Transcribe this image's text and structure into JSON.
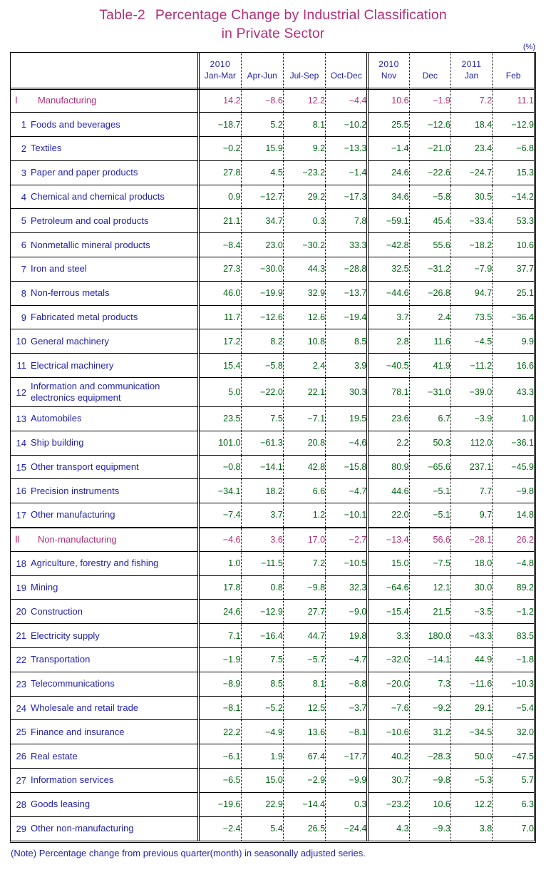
{
  "title": {
    "label": "Table-2",
    "line1": "Percentage Change by Industrial Classification",
    "line2": "in Private Sector"
  },
  "unit": "(%)",
  "note": "(Note) Percentage change from previous quarter(month) in seasonally adjusted series.",
  "colors": {
    "title": "#b0307a",
    "label_text": "#2222aa",
    "value_positive": "#006611",
    "major_row": "#b0307a"
  },
  "header": {
    "label_column": "",
    "columns": [
      {
        "year": "2010",
        "period": "Jan-Mar",
        "group": "quarter"
      },
      {
        "year": "",
        "period": "Apr-Jun",
        "group": "quarter"
      },
      {
        "year": "",
        "period": "Jul-Sep",
        "group": "quarter"
      },
      {
        "year": "",
        "period": "Oct-Dec",
        "group": "quarter"
      },
      {
        "year": "2010",
        "period": "Nov",
        "group": "month"
      },
      {
        "year": "",
        "period": "Dec",
        "group": "month"
      },
      {
        "year": "2011",
        "period": "Jan",
        "group": "month"
      },
      {
        "year": "",
        "period": "Feb",
        "group": "month"
      }
    ]
  },
  "rows": [
    {
      "num": "Ⅰ",
      "label": "Manufacturing",
      "major": true,
      "tall": false,
      "values": [
        "14.2",
        "−8.6",
        "12.2",
        "−4.4",
        "10.6",
        "−1.9",
        "7.2",
        "11.1"
      ]
    },
    {
      "num": "1",
      "label": "Foods and beverages",
      "major": false,
      "tall": false,
      "values": [
        "−18.7",
        "5.2",
        "8.1",
        "−10.2",
        "25.5",
        "−12.6",
        "18.4",
        "−12.9"
      ]
    },
    {
      "num": "2",
      "label": "Textiles",
      "major": false,
      "tall": false,
      "values": [
        "−0.2",
        "15.9",
        "9.2",
        "−13.3",
        "−1.4",
        "−21.0",
        "23.4",
        "−6.8"
      ]
    },
    {
      "num": "3",
      "label": "Paper and paper products",
      "major": false,
      "tall": false,
      "values": [
        "27.8",
        "4.5",
        "−23.2",
        "−1.4",
        "24.6",
        "−22.6",
        "−24.7",
        "15.3"
      ]
    },
    {
      "num": "4",
      "label": "Chemical and chemical products",
      "major": false,
      "tall": false,
      "values": [
        "0.9",
        "−12.7",
        "29.2",
        "−17.3",
        "34.6",
        "−5.8",
        "30.5",
        "−14.2"
      ]
    },
    {
      "num": "5",
      "label": "Petroleum and coal products",
      "major": false,
      "tall": false,
      "values": [
        "21.1",
        "34.7",
        "0.3",
        "7.8",
        "−59.1",
        "45.4",
        "−33.4",
        "53.3"
      ]
    },
    {
      "num": "6",
      "label": "Nonmetallic mineral products",
      "major": false,
      "tall": false,
      "values": [
        "−8.4",
        "23.0",
        "−30.2",
        "33.3",
        "−42.8",
        "55.6",
        "−18.2",
        "10.6"
      ]
    },
    {
      "num": "7",
      "label": "Iron and steel",
      "major": false,
      "tall": false,
      "values": [
        "27.3",
        "−30.0",
        "44.3",
        "−28.8",
        "32.5",
        "−31.2",
        "−7.9",
        "37.7"
      ]
    },
    {
      "num": "8",
      "label": "Non-ferrous metals",
      "major": false,
      "tall": false,
      "values": [
        "46.0",
        "−19.9",
        "32.9",
        "−13.7",
        "−44.6",
        "−26.8",
        "94.7",
        "25.1"
      ]
    },
    {
      "num": "9",
      "label": "Fabricated metal products",
      "major": false,
      "tall": false,
      "values": [
        "11.7",
        "−12.6",
        "12.6",
        "−19.4",
        "3.7",
        "2.4",
        "73.5",
        "−36.4"
      ]
    },
    {
      "num": "10",
      "label": "General machinery",
      "major": false,
      "tall": false,
      "values": [
        "17.2",
        "8.2",
        "10.8",
        "8.5",
        "2.8",
        "11.6",
        "−4.5",
        "9.9"
      ]
    },
    {
      "num": "11",
      "label": "Electrical machinery",
      "major": false,
      "tall": false,
      "values": [
        "15.4",
        "−5.8",
        "2.4",
        "3.9",
        "−40.5",
        "41.9",
        "−11.2",
        "16.6"
      ]
    },
    {
      "num": "12",
      "label": "Information and communication electronics equipment",
      "major": false,
      "tall": true,
      "values": [
        "5.0",
        "−22.0",
        "22.1",
        "30.3",
        "78.1",
        "−31.0",
        "−39.0",
        "43.3"
      ]
    },
    {
      "num": "13",
      "label": "Automobiles",
      "major": false,
      "tall": false,
      "values": [
        "23.5",
        "7.5",
        "−7.1",
        "19.5",
        "23.6",
        "6.7",
        "−3.9",
        "1.0"
      ]
    },
    {
      "num": "14",
      "label": "Ship building",
      "major": false,
      "tall": false,
      "values": [
        "101.0",
        "−61.3",
        "20.8",
        "−4.6",
        "2.2",
        "50.3",
        "112.0",
        "−36.1"
      ]
    },
    {
      "num": "15",
      "label": "Other transport equipment",
      "major": false,
      "tall": false,
      "values": [
        "−0.8",
        "−14.1",
        "42.8",
        "−15.8",
        "80.9",
        "−65.6",
        "237.1",
        "−45.9"
      ]
    },
    {
      "num": "16",
      "label": "Precision instruments",
      "major": false,
      "tall": false,
      "values": [
        "−34.1",
        "18.2",
        "6.6",
        "−4.7",
        "44.6",
        "−5.1",
        "7.7",
        "−9.8"
      ]
    },
    {
      "num": "17",
      "label": "Other manufacturing",
      "major": false,
      "tall": false,
      "values": [
        "−7.4",
        "3.7",
        "1.2",
        "−10.1",
        "22.0",
        "−5.1",
        "9.7",
        "14.8"
      ]
    },
    {
      "num": "Ⅱ",
      "label": "Non-manufacturing",
      "major": true,
      "tall": false,
      "values": [
        "−4.6",
        "3.6",
        "17.0",
        "−2.7",
        "−13.4",
        "56.6",
        "−28.1",
        "26.2"
      ]
    },
    {
      "num": "18",
      "label": "Agriculture, forestry and fishing",
      "major": false,
      "tall": false,
      "values": [
        "1.0",
        "−11.5",
        "7.2",
        "−10.5",
        "15.0",
        "−7.5",
        "18.0",
        "−4.8"
      ]
    },
    {
      "num": "19",
      "label": "Mining",
      "major": false,
      "tall": false,
      "values": [
        "17.8",
        "0.8",
        "−9.8",
        "32.3",
        "−64.6",
        "12.1",
        "30.0",
        "89.2"
      ]
    },
    {
      "num": "20",
      "label": "Construction",
      "major": false,
      "tall": false,
      "values": [
        "24.6",
        "−12.9",
        "27.7",
        "−9.0",
        "−15.4",
        "21.5",
        "−3.5",
        "−1.2"
      ]
    },
    {
      "num": "21",
      "label": "Electricity supply",
      "major": false,
      "tall": false,
      "values": [
        "7.1",
        "−16.4",
        "44.7",
        "19.8",
        "3.3",
        "180.0",
        "−43.3",
        "83.5"
      ]
    },
    {
      "num": "22",
      "label": "Transportation",
      "major": false,
      "tall": false,
      "values": [
        "−1.9",
        "7.5",
        "−5.7",
        "−4.7",
        "−32.0",
        "−14.1",
        "44.9",
        "−1.8"
      ]
    },
    {
      "num": "23",
      "label": "Telecommunications",
      "major": false,
      "tall": false,
      "values": [
        "−8.9",
        "8.5",
        "8.1",
        "−8.8",
        "−20.0",
        "7.3",
        "−11.6",
        "−10.3"
      ]
    },
    {
      "num": "24",
      "label": "Wholesale and retail trade",
      "major": false,
      "tall": false,
      "values": [
        "−8.1",
        "−5.2",
        "12.5",
        "−3.7",
        "−7.6",
        "−9.2",
        "29.1",
        "−5.4"
      ]
    },
    {
      "num": "25",
      "label": "Finance and insurance",
      "major": false,
      "tall": false,
      "values": [
        "22.2",
        "−4.9",
        "13.6",
        "−8.1",
        "−10.6",
        "31.2",
        "−34.5",
        "32.0"
      ]
    },
    {
      "num": "26",
      "label": "Real estate",
      "major": false,
      "tall": false,
      "values": [
        "−6.1",
        "1.9",
        "67.4",
        "−17.7",
        "40.2",
        "−28.3",
        "50.0",
        "−47.5"
      ]
    },
    {
      "num": "27",
      "label": "Information services",
      "major": false,
      "tall": false,
      "values": [
        "−6.5",
        "15.0",
        "−2.9",
        "−9.9",
        "30.7",
        "−9.8",
        "−5.3",
        "5.7"
      ]
    },
    {
      "num": "28",
      "label": "Goods leasing",
      "major": false,
      "tall": false,
      "values": [
        "−19.6",
        "22.9",
        "−14.4",
        "0.3",
        "−23.2",
        "10.6",
        "12.2",
        "6.3"
      ]
    },
    {
      "num": "29",
      "label": "Other non-manufacturing",
      "major": false,
      "tall": false,
      "values": [
        "−2.4",
        "5.4",
        "26.5",
        "−24.4",
        "4.3",
        "−9.3",
        "3.8",
        "7.0"
      ]
    }
  ],
  "chart_data": {
    "type": "table",
    "title": "Table-2 Percentage Change by Industrial Classification in Private Sector",
    "unit": "%",
    "columns": [
      "Industry",
      "2010 Jan-Mar",
      "Apr-Jun",
      "Jul-Sep",
      "Oct-Dec",
      "2010 Nov",
      "Dec",
      "2011 Jan",
      "Feb"
    ],
    "rows": [
      [
        "I Manufacturing",
        14.2,
        -8.6,
        12.2,
        -4.4,
        10.6,
        -1.9,
        7.2,
        11.1
      ],
      [
        "1 Foods and beverages",
        -18.7,
        5.2,
        8.1,
        -10.2,
        25.5,
        -12.6,
        18.4,
        -12.9
      ],
      [
        "2 Textiles",
        -0.2,
        15.9,
        9.2,
        -13.3,
        -1.4,
        -21.0,
        23.4,
        -6.8
      ],
      [
        "3 Paper and paper products",
        27.8,
        4.5,
        -23.2,
        -1.4,
        24.6,
        -22.6,
        -24.7,
        15.3
      ],
      [
        "4 Chemical and chemical products",
        0.9,
        -12.7,
        29.2,
        -17.3,
        34.6,
        -5.8,
        30.5,
        -14.2
      ],
      [
        "5 Petroleum and coal products",
        21.1,
        34.7,
        0.3,
        7.8,
        -59.1,
        45.4,
        -33.4,
        53.3
      ],
      [
        "6 Nonmetallic mineral products",
        -8.4,
        23.0,
        -30.2,
        33.3,
        -42.8,
        55.6,
        -18.2,
        10.6
      ],
      [
        "7 Iron and steel",
        27.3,
        -30.0,
        44.3,
        -28.8,
        32.5,
        -31.2,
        -7.9,
        37.7
      ],
      [
        "8 Non-ferrous metals",
        46.0,
        -19.9,
        32.9,
        -13.7,
        -44.6,
        -26.8,
        94.7,
        25.1
      ],
      [
        "9 Fabricated metal products",
        11.7,
        -12.6,
        12.6,
        -19.4,
        3.7,
        2.4,
        73.5,
        -36.4
      ],
      [
        "10 General machinery",
        17.2,
        8.2,
        10.8,
        8.5,
        2.8,
        11.6,
        -4.5,
        9.9
      ],
      [
        "11 Electrical machinery",
        15.4,
        -5.8,
        2.4,
        3.9,
        -40.5,
        41.9,
        -11.2,
        16.6
      ],
      [
        "12 Information and communication electronics equipment",
        5.0,
        -22.0,
        22.1,
        30.3,
        78.1,
        -31.0,
        -39.0,
        43.3
      ],
      [
        "13 Automobiles",
        23.5,
        7.5,
        -7.1,
        19.5,
        23.6,
        6.7,
        -3.9,
        1.0
      ],
      [
        "14 Ship building",
        101.0,
        -61.3,
        20.8,
        -4.6,
        2.2,
        50.3,
        112.0,
        -36.1
      ],
      [
        "15 Other transport equipment",
        -0.8,
        -14.1,
        42.8,
        -15.8,
        80.9,
        -65.6,
        237.1,
        -45.9
      ],
      [
        "16 Precision instruments",
        -34.1,
        18.2,
        6.6,
        -4.7,
        44.6,
        -5.1,
        7.7,
        -9.8
      ],
      [
        "17 Other manufacturing",
        -7.4,
        3.7,
        1.2,
        -10.1,
        22.0,
        -5.1,
        9.7,
        14.8
      ],
      [
        "II Non-manufacturing",
        -4.6,
        3.6,
        17.0,
        -2.7,
        -13.4,
        56.6,
        -28.1,
        26.2
      ],
      [
        "18 Agriculture, forestry and fishing",
        1.0,
        -11.5,
        7.2,
        -10.5,
        15.0,
        -7.5,
        18.0,
        -4.8
      ],
      [
        "19 Mining",
        17.8,
        0.8,
        -9.8,
        32.3,
        -64.6,
        12.1,
        30.0,
        89.2
      ],
      [
        "20 Construction",
        24.6,
        -12.9,
        27.7,
        -9.0,
        -15.4,
        21.5,
        -3.5,
        -1.2
      ],
      [
        "21 Electricity supply",
        7.1,
        -16.4,
        44.7,
        19.8,
        3.3,
        180.0,
        -43.3,
        83.5
      ],
      [
        "22 Transportation",
        -1.9,
        7.5,
        -5.7,
        -4.7,
        -32.0,
        -14.1,
        44.9,
        -1.8
      ],
      [
        "23 Telecommunications",
        -8.9,
        8.5,
        8.1,
        -8.8,
        -20.0,
        7.3,
        -11.6,
        -10.3
      ],
      [
        "24 Wholesale and retail trade",
        -8.1,
        -5.2,
        12.5,
        -3.7,
        -7.6,
        -9.2,
        29.1,
        -5.4
      ],
      [
        "25 Finance and insurance",
        22.2,
        -4.9,
        13.6,
        -8.1,
        -10.6,
        31.2,
        -34.5,
        32.0
      ],
      [
        "26 Real estate",
        -6.1,
        1.9,
        67.4,
        -17.7,
        40.2,
        -28.3,
        50.0,
        -47.5
      ],
      [
        "27 Information services",
        -6.5,
        15.0,
        -2.9,
        -9.9,
        30.7,
        -9.8,
        -5.3,
        5.7
      ],
      [
        "28 Goods leasing",
        -19.6,
        22.9,
        -14.4,
        0.3,
        -23.2,
        10.6,
        12.2,
        6.3
      ],
      [
        "29 Other non-manufacturing",
        -2.4,
        5.4,
        26.5,
        -24.4,
        4.3,
        -9.3,
        3.8,
        7.0
      ]
    ]
  }
}
